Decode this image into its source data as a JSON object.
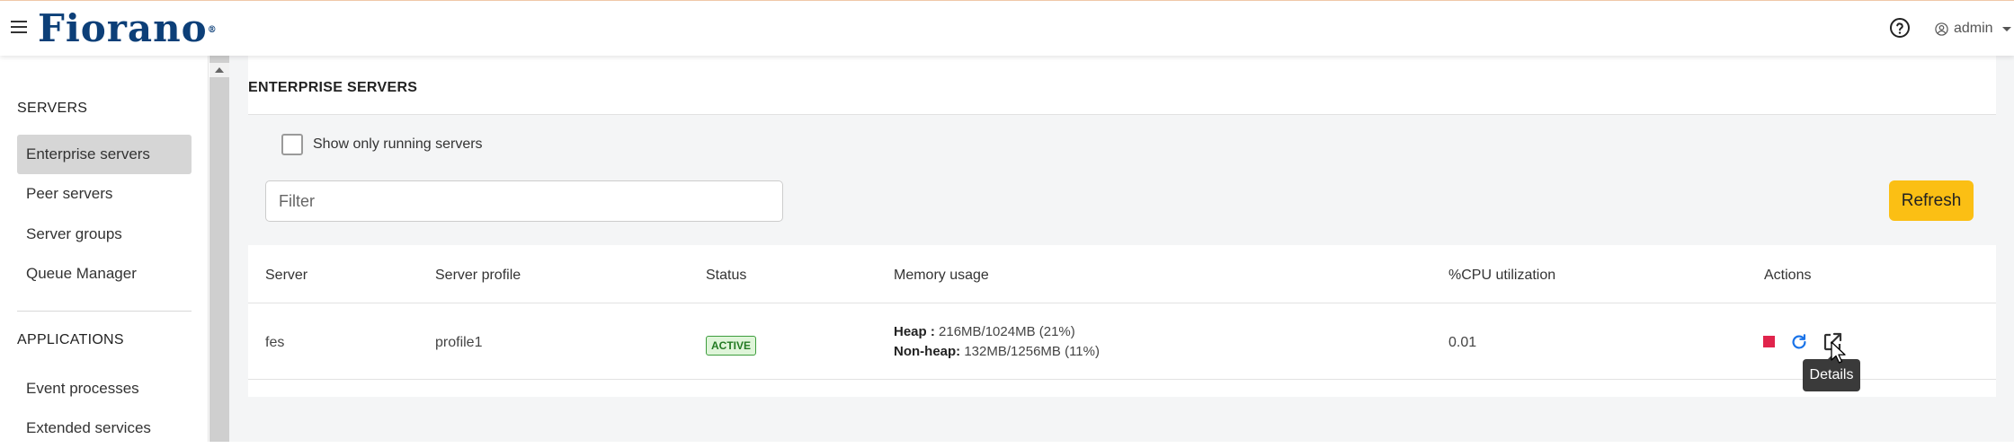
{
  "header": {
    "logo_text": "Fiorano",
    "logo_mark": "®",
    "user_label": "admin"
  },
  "sidebar": {
    "servers_heading": "SERVERS",
    "server_items": [
      {
        "label": "Enterprise servers",
        "active": true
      },
      {
        "label": "Peer servers",
        "active": false
      },
      {
        "label": "Server groups",
        "active": false
      },
      {
        "label": "Queue Manager",
        "active": false
      }
    ],
    "applications_heading": "APPLICATIONS",
    "application_items": [
      {
        "label": "Event processes"
      },
      {
        "label": "Extended services"
      }
    ]
  },
  "main": {
    "title": "ENTERPRISE SERVERS",
    "show_running_label": "Show only running servers",
    "filter_placeholder": "Filter",
    "refresh_label": "Refresh"
  },
  "table": {
    "columns": [
      "Server",
      "Server profile",
      "Status",
      "Memory usage",
      "%CPU utilization",
      "Actions"
    ],
    "rows": [
      {
        "server": "fes",
        "profile": "profile1",
        "status": "ACTIVE",
        "heap_label": "Heap :",
        "heap_value": "216MB/1024MB (21%)",
        "nonheap_label": "Non-heap:",
        "nonheap_value": "132MB/1256MB (11%)",
        "cpu": "0.01"
      }
    ]
  },
  "tooltip": {
    "text": "Details"
  },
  "colors": {
    "brand": "#0c3f78",
    "refresh_button": "#fbbf14",
    "stop_action": "#e0244c",
    "restart_action": "#1a73e8",
    "active_badge": "#237a23"
  },
  "icons": [
    "hamburger-icon",
    "help-icon",
    "user-icon",
    "stop-icon",
    "restart-icon",
    "details-icon"
  ]
}
